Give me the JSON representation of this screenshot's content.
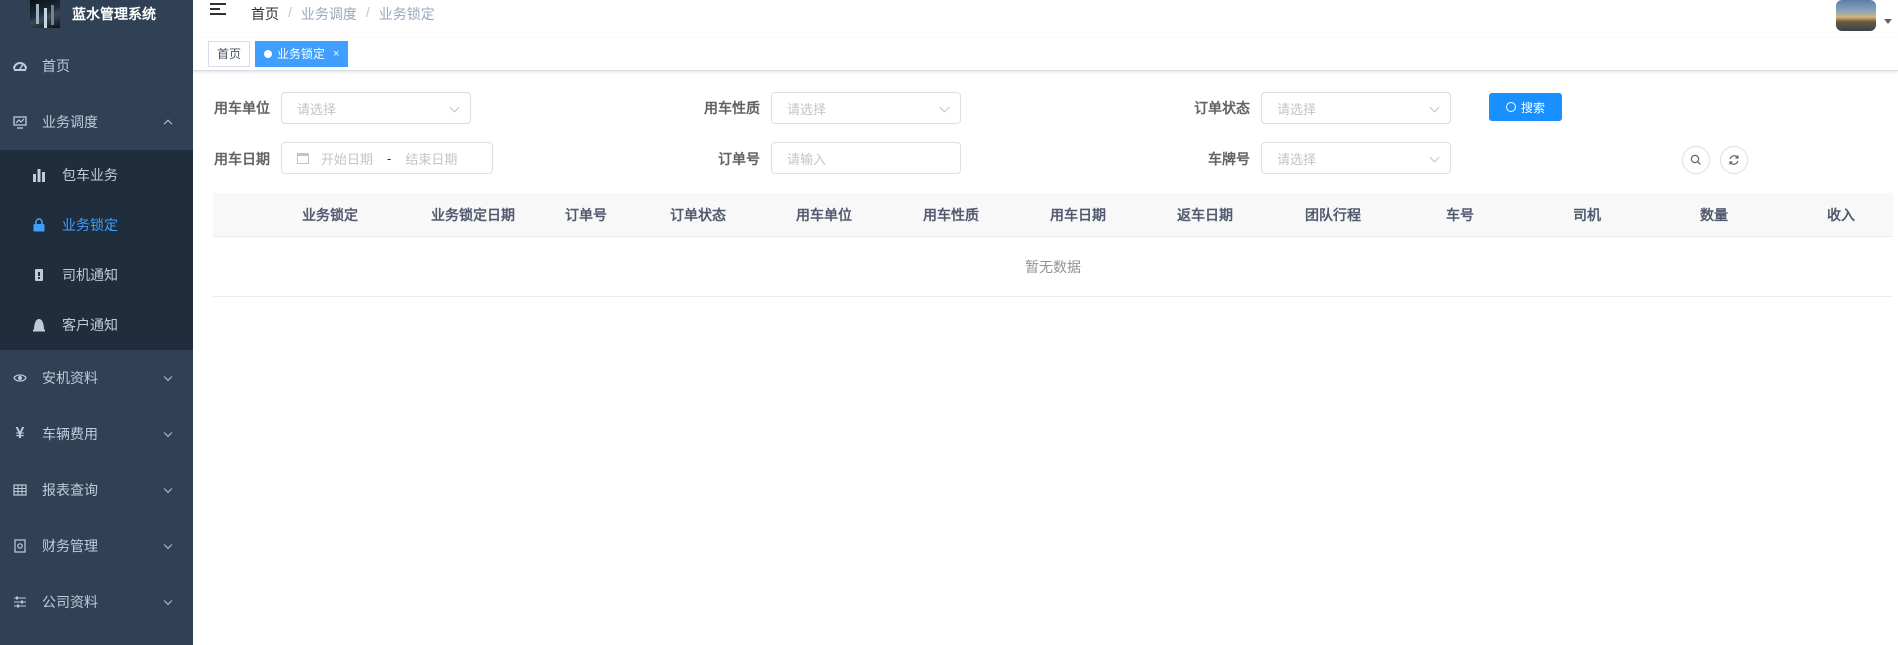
{
  "app": {
    "title": "蓝水管理系统"
  },
  "sidebar": {
    "items": [
      {
        "label": "首页",
        "icon": "dashboard-icon"
      },
      {
        "label": "业务调度",
        "icon": "monitor-icon",
        "expanded": true,
        "children": [
          {
            "label": "包车业务",
            "icon": "bar-chart-icon"
          },
          {
            "label": "业务锁定",
            "icon": "lock-icon",
            "active": true
          },
          {
            "label": "司机通知",
            "icon": "notice-icon"
          },
          {
            "label": "客户通知",
            "icon": "user-bell-icon"
          }
        ]
      },
      {
        "label": "安机资料",
        "icon": "eye-icon"
      },
      {
        "label": "车辆费用",
        "icon": "yen-icon"
      },
      {
        "label": "报表查询",
        "icon": "table-icon"
      },
      {
        "label": "财务管理",
        "icon": "finance-icon"
      },
      {
        "label": "公司资料",
        "icon": "sliders-icon"
      }
    ]
  },
  "breadcrumb": [
    "首页",
    "业务调度",
    "业务锁定"
  ],
  "tags": [
    {
      "label": "首页",
      "active": false
    },
    {
      "label": "业务锁定",
      "active": true,
      "close": "×"
    }
  ],
  "form": {
    "use_unit": {
      "label": "用车单位",
      "placeholder": "请选择"
    },
    "use_nature": {
      "label": "用车性质",
      "placeholder": "请选择"
    },
    "order_status": {
      "label": "订单状态",
      "placeholder": "请选择"
    },
    "use_date": {
      "label": "用车日期",
      "start_placeholder": "开始日期",
      "separator": "-",
      "end_placeholder": "结束日期"
    },
    "order_no": {
      "label": "订单号",
      "placeholder": "请输入"
    },
    "plate_no": {
      "label": "车牌号",
      "placeholder": "请选择"
    },
    "search_button": "搜索"
  },
  "table": {
    "columns": [
      "业务锁定",
      "业务锁定日期",
      "订单号",
      "订单状态",
      "用车单位",
      "用车性质",
      "用车日期",
      "返车日期",
      "团队行程",
      "车号",
      "司机",
      "数量",
      "收入"
    ],
    "empty_text": "暂无数据"
  },
  "colors": {
    "sidebar_bg": "#304156",
    "submenu_bg": "#1f2d3d",
    "accent": "#409eff",
    "primary_button": "#1890ff"
  }
}
